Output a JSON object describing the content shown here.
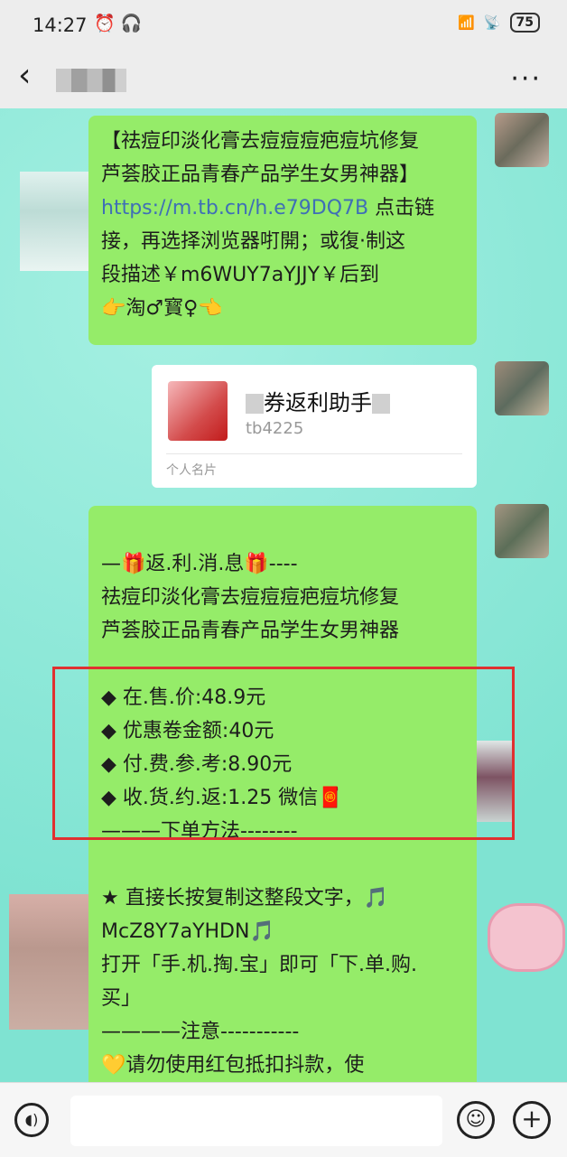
{
  "status": {
    "time": "14:27",
    "battery": "75",
    "alarm_icon": "alarm-icon",
    "headset_icon": "headset-icon"
  },
  "nav": {
    "back_icon": "back-chevron-icon",
    "more": "···"
  },
  "msg1": {
    "lines": [
      "【祛痘印淡化膏去痘痘痘疤痘坑修复",
      "芦荟胶正品青春产品学生女男神器】"
    ],
    "link": "https://m.tb.cn/h.e79DQ7B",
    "after_link": " 点击链",
    "lines2": [
      "接，再选择浏览器咑開；或復·制这",
      "段描述￥m6WUY7aYJJY￥后到",
      "👉淘♂寳♀👈"
    ]
  },
  "card": {
    "name": "券返利助手",
    "id": "tb4225",
    "footer": "个人名片"
  },
  "msg2": {
    "lines": [
      "—🎁返.利.消.息🎁----",
      "祛痘印淡化膏去痘痘痘疤痘坑修复",
      "芦荟胶正品青春产品学生女男神器",
      "",
      "◆ 在.售.价:48.9元",
      "◆ 优惠卷金额:40元",
      "◆ 付.费.参.考:8.90元",
      "◆ 收.货.约.返:1.25 微信🧧",
      "———下单方法--------",
      "",
      "★ 直接长按复制这整段文字，🎵",
      "McZ8Y7aYHDN🎵",
      "打开「手.机.掏.宝」即可「下.单.购.",
      "买」",
      "————注意-----------",
      "💛请勿使用红包抵扣抖款，使"
    ]
  }
}
